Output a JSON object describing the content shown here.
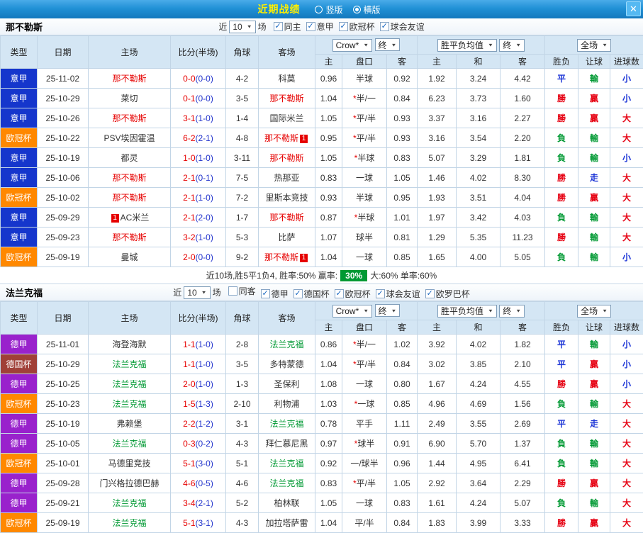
{
  "titlebar": {
    "title": "近期战绩",
    "radios": [
      {
        "label": "竖版",
        "selected": false
      },
      {
        "label": "横版",
        "selected": true
      }
    ],
    "close": "✕"
  },
  "colors": {
    "leagues": {
      "意甲": "#1536cc",
      "欧冠杯": "#ff8800",
      "德甲": "#9922cc",
      "德国杯": "#a04038"
    },
    "team_red": "#e60000",
    "team_green": "#009933",
    "win_badge_bg": "#009933"
  },
  "table_header": {
    "cols": [
      "类型",
      "日期",
      "主场",
      "比分(半场)",
      "角球",
      "客场"
    ],
    "odds_group": {
      "select1": "Crow*",
      "select2": "终",
      "cols": [
        "主",
        "盘口",
        "客"
      ]
    },
    "avg_group": {
      "select1": "胜平负均值",
      "select2": "终",
      "cols": [
        "主",
        "和",
        "客"
      ]
    },
    "result_group": {
      "select1": "全场",
      "cols": [
        "胜负",
        "让球",
        "进球数"
      ]
    }
  },
  "sections": [
    {
      "team": "那不勒斯",
      "filter": {
        "near": "近",
        "count": "10",
        "unit": "场",
        "checks": [
          {
            "label": "同主",
            "checked": true
          },
          {
            "label": "意甲",
            "checked": true
          },
          {
            "label": "欧冠杯",
            "checked": true
          },
          {
            "label": "球会友谊",
            "checked": true
          }
        ]
      },
      "rows": [
        {
          "league": "意甲",
          "date": "25-11-02",
          "home": {
            "name": "那不勒斯",
            "cls": "t-red"
          },
          "score": {
            "ft": "0-0",
            "ht": "(0-0)"
          },
          "corners": "4-2",
          "away": {
            "name": "科莫"
          },
          "odds": [
            "0.96",
            "半球",
            "0.92"
          ],
          "avg": [
            "1.92",
            "3.24",
            "4.42"
          ],
          "results": [
            "平",
            "輸",
            "小"
          ]
        },
        {
          "league": "意甲",
          "date": "25-10-29",
          "home": {
            "name": "莱切"
          },
          "score": {
            "ft": "0-1",
            "ht": "(0-0)"
          },
          "corners": "3-5",
          "away": {
            "name": "那不勒斯",
            "cls": "t-red"
          },
          "odds": [
            "1.04",
            "*半/一",
            "0.84"
          ],
          "avg": [
            "6.23",
            "3.73",
            "1.60"
          ],
          "results": [
            "勝",
            "贏",
            "小"
          ]
        },
        {
          "league": "意甲",
          "date": "25-10-26",
          "home": {
            "name": "那不勒斯",
            "cls": "t-red"
          },
          "score": {
            "ft": "3-1",
            "ht": "(1-0)"
          },
          "corners": "1-4",
          "away": {
            "name": "国际米兰"
          },
          "odds": [
            "1.05",
            "*平/半",
            "0.93"
          ],
          "avg": [
            "3.37",
            "3.16",
            "2.27"
          ],
          "results": [
            "勝",
            "贏",
            "大"
          ]
        },
        {
          "league": "欧冠杯",
          "date": "25-10-22",
          "home": {
            "name": "PSV埃因霍温"
          },
          "score": {
            "ft": "6-2",
            "ht": "(2-1)"
          },
          "corners": "4-8",
          "away": {
            "name": "那不勒斯",
            "cls": "t-red",
            "badge": "1"
          },
          "odds": [
            "0.95",
            "*平/半",
            "0.93"
          ],
          "avg": [
            "3.16",
            "3.54",
            "2.20"
          ],
          "results": [
            "負",
            "輸",
            "大"
          ]
        },
        {
          "league": "意甲",
          "date": "25-10-19",
          "home": {
            "name": "都灵"
          },
          "score": {
            "ft": "1-0",
            "ht": "(1-0)"
          },
          "corners": "3-11",
          "away": {
            "name": "那不勒斯",
            "cls": "t-red"
          },
          "odds": [
            "1.05",
            "*半球",
            "0.83"
          ],
          "avg": [
            "5.07",
            "3.29",
            "1.81"
          ],
          "results": [
            "負",
            "輸",
            "小"
          ]
        },
        {
          "league": "意甲",
          "date": "25-10-06",
          "home": {
            "name": "那不勒斯",
            "cls": "t-red"
          },
          "score": {
            "ft": "2-1",
            "ht": "(0-1)"
          },
          "corners": "7-5",
          "away": {
            "name": "热那亚"
          },
          "odds": [
            "0.83",
            "一球",
            "1.05"
          ],
          "avg": [
            "1.46",
            "4.02",
            "8.30"
          ],
          "results": [
            "勝",
            "走",
            "大"
          ]
        },
        {
          "league": "欧冠杯",
          "date": "25-10-02",
          "home": {
            "name": "那不勒斯",
            "cls": "t-red"
          },
          "score": {
            "ft": "2-1",
            "ht": "(1-0)"
          },
          "corners": "7-2",
          "away": {
            "name": "里斯本竞技"
          },
          "odds": [
            "0.93",
            "半球",
            "0.95"
          ],
          "avg": [
            "1.93",
            "3.51",
            "4.04"
          ],
          "results": [
            "勝",
            "贏",
            "大"
          ]
        },
        {
          "league": "意甲",
          "date": "25-09-29",
          "home": {
            "name": "AC米兰",
            "badge": "1",
            "badgePos": "before"
          },
          "score": {
            "ft": "2-1",
            "ht": "(2-0)"
          },
          "corners": "1-7",
          "away": {
            "name": "那不勒斯",
            "cls": "t-red"
          },
          "odds": [
            "0.87",
            "*半球",
            "1.01"
          ],
          "avg": [
            "1.97",
            "3.42",
            "4.03"
          ],
          "results": [
            "負",
            "輸",
            "大"
          ]
        },
        {
          "league": "意甲",
          "date": "25-09-23",
          "home": {
            "name": "那不勒斯",
            "cls": "t-red"
          },
          "score": {
            "ft": "3-2",
            "ht": "(1-0)"
          },
          "corners": "5-3",
          "away": {
            "name": "比萨"
          },
          "odds": [
            "1.07",
            "球半",
            "0.81"
          ],
          "avg": [
            "1.29",
            "5.35",
            "11.23"
          ],
          "results": [
            "勝",
            "輸",
            "大"
          ]
        },
        {
          "league": "欧冠杯",
          "date": "25-09-19",
          "home": {
            "name": "曼城"
          },
          "score": {
            "ft": "2-0",
            "ht": "(0-0)"
          },
          "corners": "9-2",
          "away": {
            "name": "那不勒斯",
            "cls": "t-red",
            "badge": "1"
          },
          "odds": [
            "1.04",
            "一球",
            "0.85"
          ],
          "avg": [
            "1.65",
            "4.00",
            "5.05"
          ],
          "results": [
            "負",
            "輸",
            "小"
          ]
        }
      ],
      "summary": {
        "before": "近10场,胜5平1负4, 胜率:50% 赢率: ",
        "badge": "30%",
        "after": " 大:60% 单率:60%"
      }
    },
    {
      "team": "法兰克福",
      "filter": {
        "near": "近",
        "count": "10",
        "unit": "场",
        "checks": [
          {
            "label": "同客",
            "checked": false
          },
          {
            "label": "德甲",
            "checked": true
          },
          {
            "label": "德国杯",
            "checked": true
          },
          {
            "label": "欧冠杯",
            "checked": true
          },
          {
            "label": "球会友谊",
            "checked": true
          },
          {
            "label": "欧罗巴杯",
            "checked": true
          }
        ]
      },
      "rows": [
        {
          "league": "德甲",
          "date": "25-11-01",
          "home": {
            "name": "海登海默"
          },
          "score": {
            "ft": "1-1",
            "ht": "(1-0)"
          },
          "corners": "2-8",
          "away": {
            "name": "法兰克福",
            "cls": "t-green"
          },
          "odds": [
            "0.86",
            "*半/一",
            "1.02"
          ],
          "avg": [
            "3.92",
            "4.02",
            "1.82"
          ],
          "results": [
            "平",
            "輸",
            "小"
          ]
        },
        {
          "league": "德国杯",
          "date": "25-10-29",
          "home": {
            "name": "法兰克福",
            "cls": "t-green"
          },
          "score": {
            "ft": "1-1",
            "ht": "(1-0)"
          },
          "corners": "3-5",
          "away": {
            "name": "多特蒙德"
          },
          "odds": [
            "1.04",
            "*平/半",
            "0.84"
          ],
          "avg": [
            "3.02",
            "3.85",
            "2.10"
          ],
          "results": [
            "平",
            "贏",
            "小"
          ]
        },
        {
          "league": "德甲",
          "date": "25-10-25",
          "home": {
            "name": "法兰克福",
            "cls": "t-green"
          },
          "score": {
            "ft": "2-0",
            "ht": "(1-0)"
          },
          "corners": "1-3",
          "away": {
            "name": "圣保利"
          },
          "odds": [
            "1.08",
            "一球",
            "0.80"
          ],
          "avg": [
            "1.67",
            "4.24",
            "4.55"
          ],
          "results": [
            "勝",
            "贏",
            "小"
          ]
        },
        {
          "league": "欧冠杯",
          "date": "25-10-23",
          "home": {
            "name": "法兰克福",
            "cls": "t-green"
          },
          "score": {
            "ft": "1-5",
            "ht": "(1-3)"
          },
          "corners": "2-10",
          "away": {
            "name": "利物浦"
          },
          "odds": [
            "1.03",
            "*一球",
            "0.85"
          ],
          "avg": [
            "4.96",
            "4.69",
            "1.56"
          ],
          "results": [
            "負",
            "輸",
            "大"
          ]
        },
        {
          "league": "德甲",
          "date": "25-10-19",
          "home": {
            "name": "弗赖堡"
          },
          "score": {
            "ft": "2-2",
            "ht": "(1-2)"
          },
          "corners": "3-1",
          "away": {
            "name": "法兰克福",
            "cls": "t-green"
          },
          "odds": [
            "0.78",
            "平手",
            "1.11"
          ],
          "avg": [
            "2.49",
            "3.55",
            "2.69"
          ],
          "results": [
            "平",
            "走",
            "大"
          ]
        },
        {
          "league": "德甲",
          "date": "25-10-05",
          "home": {
            "name": "法兰克福",
            "cls": "t-green"
          },
          "score": {
            "ft": "0-3",
            "ht": "(0-2)"
          },
          "corners": "4-3",
          "away": {
            "name": "拜仁慕尼黑"
          },
          "odds": [
            "0.97",
            "*球半",
            "0.91"
          ],
          "avg": [
            "6.90",
            "5.70",
            "1.37"
          ],
          "results": [
            "負",
            "輸",
            "大"
          ]
        },
        {
          "league": "欧冠杯",
          "date": "25-10-01",
          "home": {
            "name": "马德里竞技"
          },
          "score": {
            "ft": "5-1",
            "ht": "(3-0)"
          },
          "corners": "5-1",
          "away": {
            "name": "法兰克福",
            "cls": "t-green"
          },
          "odds": [
            "0.92",
            "一/球半",
            "0.96"
          ],
          "avg": [
            "1.44",
            "4.95",
            "6.41"
          ],
          "results": [
            "負",
            "輸",
            "大"
          ]
        },
        {
          "league": "德甲",
          "date": "25-09-28",
          "home": {
            "name": "门兴格拉德巴赫"
          },
          "score": {
            "ft": "4-6",
            "ht": "(0-5)"
          },
          "corners": "4-6",
          "away": {
            "name": "法兰克福",
            "cls": "t-green"
          },
          "odds": [
            "0.83",
            "*平/半",
            "1.05"
          ],
          "avg": [
            "2.92",
            "3.64",
            "2.29"
          ],
          "results": [
            "勝",
            "贏",
            "大"
          ]
        },
        {
          "league": "德甲",
          "date": "25-09-21",
          "home": {
            "name": "法兰克福",
            "cls": "t-green"
          },
          "score": {
            "ft": "3-4",
            "ht": "(2-1)"
          },
          "corners": "5-2",
          "away": {
            "name": "柏林联"
          },
          "odds": [
            "1.05",
            "一球",
            "0.83"
          ],
          "avg": [
            "1.61",
            "4.24",
            "5.07"
          ],
          "results": [
            "負",
            "輸",
            "大"
          ]
        },
        {
          "league": "欧冠杯",
          "date": "25-09-19",
          "home": {
            "name": "法兰克福",
            "cls": "t-green"
          },
          "score": {
            "ft": "5-1",
            "ht": "(3-1)"
          },
          "corners": "4-3",
          "away": {
            "name": "加拉塔萨雷"
          },
          "odds": [
            "1.04",
            "平/半",
            "0.84"
          ],
          "avg": [
            "1.83",
            "3.99",
            "3.33"
          ],
          "results": [
            "勝",
            "贏",
            "大"
          ]
        }
      ],
      "summary": null
    }
  ]
}
